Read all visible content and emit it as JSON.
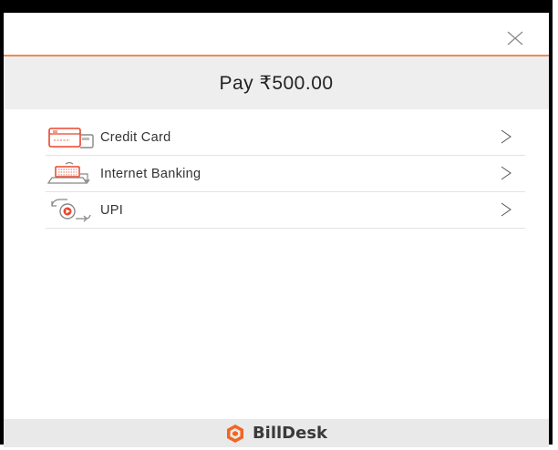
{
  "header": {
    "close_icon": "close-icon"
  },
  "payment": {
    "amount_text": "Pay ₹500.00"
  },
  "methods": [
    {
      "label": "Credit Card",
      "icon": "credit-card-icon"
    },
    {
      "label": "Internet Banking",
      "icon": "internet-banking-icon"
    },
    {
      "label": "UPI",
      "icon": "upi-icon"
    }
  ],
  "footer": {
    "brand_name": "BillDesk"
  },
  "colors": {
    "accent": "#f08a52",
    "brand_orange": "#f26522",
    "icon_red": "#e8452c",
    "amount_bg": "#eeeeee",
    "footer_bg": "#e9e9e9"
  }
}
